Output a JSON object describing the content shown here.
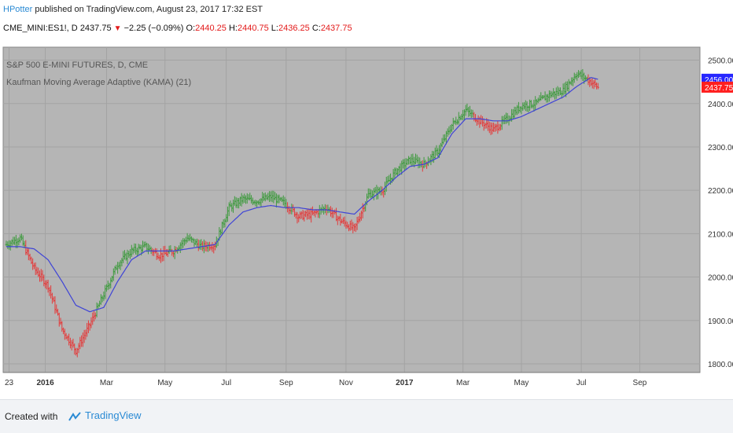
{
  "header": {
    "author": "HPotter",
    "published": "published on TradingView.com, August 23, 2017 17:32 EST",
    "symbol": "CME_MINI:ES1!, D",
    "last": "2437.75",
    "change": "−2.25 (−0.09%)",
    "o_label": "O:",
    "o": "2440.25",
    "h_label": "H:",
    "h": "2440.75",
    "l_label": "L:",
    "l": "2436.25",
    "c_label": "C:",
    "c": "2437.75"
  },
  "footer": {
    "created": "Created with",
    "brand": "TradingView"
  },
  "colors": {
    "up": "#3e9a3e",
    "down": "#e33b3b",
    "kama": "#3f44d6",
    "plot_bg": "#b5b5b5",
    "grid": "#a3a3a3",
    "price_tag_blue": "#2727ff",
    "price_tag_red": "#ff1e1e"
  },
  "chart_data": {
    "type": "line",
    "overlay_title": "S&P 500 E-MINI FUTURES, D, CME",
    "indicator_title": "Kaufman Moving Average Adaptive (KAMA) (21)",
    "x_ticks": [
      "23",
      "2016",
      "Mar",
      "May",
      "Jul",
      "Sep",
      "Nov",
      "2017",
      "Mar",
      "May",
      "Jul",
      "Sep"
    ],
    "y_ticks": [
      "2500.00",
      "2400.00",
      "2300.00",
      "2200.00",
      "2100.00",
      "2000.00",
      "1900.00",
      "1800.00"
    ],
    "ylim": [
      1780,
      2530
    ],
    "last_price_labels": [
      {
        "value": 2456.0,
        "text": "2456.00",
        "color": "blue"
      },
      {
        "value": 2437.75,
        "text": "2437.75",
        "color": "red"
      }
    ],
    "series": [
      {
        "name": "Price",
        "note": "approximate daily closes (trading-day index)",
        "x": [
          0,
          10,
          20,
          30,
          40,
          50,
          60,
          70,
          80,
          90,
          100,
          110,
          120,
          130,
          140,
          150,
          160,
          170,
          180,
          190,
          200,
          210,
          220,
          230,
          240,
          250,
          260,
          270,
          280,
          290,
          300,
          310,
          320,
          330,
          340,
          350,
          360,
          370,
          380,
          390,
          400,
          410,
          420,
          425
        ],
        "values": [
          2075,
          2090,
          2020,
          1980,
          1880,
          1830,
          1890,
          1960,
          2030,
          2060,
          2070,
          2050,
          2060,
          2090,
          2070,
          2075,
          2160,
          2180,
          2175,
          2185,
          2170,
          2140,
          2145,
          2160,
          2130,
          2110,
          2190,
          2200,
          2245,
          2270,
          2260,
          2290,
          2350,
          2385,
          2360,
          2340,
          2365,
          2395,
          2400,
          2420,
          2430,
          2470,
          2450,
          2437
        ]
      },
      {
        "name": "KAMA",
        "x": [
          0,
          10,
          20,
          30,
          40,
          50,
          60,
          70,
          80,
          90,
          100,
          110,
          120,
          130,
          140,
          150,
          160,
          170,
          180,
          190,
          200,
          210,
          220,
          230,
          240,
          250,
          260,
          270,
          280,
          290,
          300,
          310,
          320,
          330,
          340,
          350,
          360,
          370,
          380,
          390,
          400,
          410,
          420,
          425
        ],
        "values": [
          2070,
          2070,
          2065,
          2040,
          1990,
          1935,
          1920,
          1930,
          1990,
          2040,
          2060,
          2060,
          2060,
          2065,
          2070,
          2075,
          2120,
          2150,
          2160,
          2165,
          2160,
          2160,
          2155,
          2155,
          2150,
          2145,
          2175,
          2200,
          2230,
          2255,
          2260,
          2275,
          2330,
          2365,
          2365,
          2360,
          2360,
          2370,
          2385,
          2400,
          2415,
          2440,
          2460,
          2456
        ]
      }
    ]
  }
}
